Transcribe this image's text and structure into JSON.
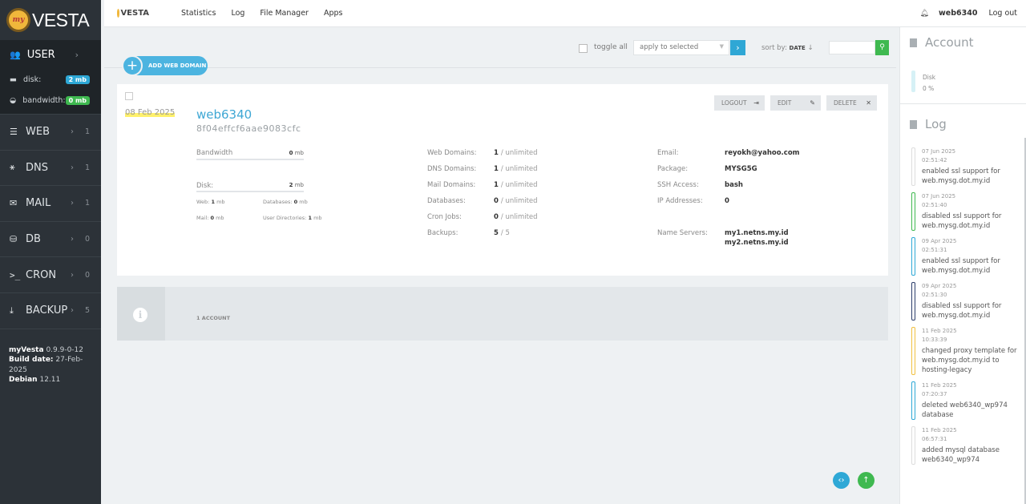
{
  "sidebar": {
    "logo_text": "VESTA",
    "logo_badge": "my",
    "user": {
      "label": "USER",
      "arrow": "›"
    },
    "stats": [
      {
        "label": "disk:",
        "value": "2 mb",
        "color": "#2ea8d6"
      },
      {
        "label": "bandwidth:",
        "value": "0 mb",
        "color": "#3fb950"
      }
    ],
    "nav": [
      {
        "label": "WEB",
        "count": "1",
        "icon": "web-icon"
      },
      {
        "label": "DNS",
        "count": "1",
        "icon": "dns-icon"
      },
      {
        "label": "MAIL",
        "count": "1",
        "icon": "mail-icon"
      },
      {
        "label": "DB",
        "count": "0",
        "icon": "db-icon"
      },
      {
        "label": "CRON",
        "count": "0",
        "icon": "cron-icon"
      },
      {
        "label": "BACKUP",
        "count": "5",
        "icon": "backup-icon"
      }
    ],
    "version": {
      "name": "myVesta",
      "version": "0.9.9-0-12",
      "build_label": "Build date:",
      "build": "27-Feb-2025",
      "os": "Debian",
      "os_version": "12.11"
    }
  },
  "topbar": {
    "logo": "VESTA",
    "links": [
      "Statistics",
      "Log",
      "File Manager",
      "Apps"
    ],
    "username": "web6340",
    "logout": "Log out"
  },
  "toolbar": {
    "toggle_all": "toggle all",
    "apply_placeholder": "apply to selected",
    "sort_label": "sort by:",
    "sort_value": "DATE",
    "add_label": "ADD WEB DOMAIN"
  },
  "card": {
    "date": "08 Feb 2025",
    "name": "web6340",
    "hash": "8f04effcf6aae9083cfc",
    "buttons": {
      "logout": "LOGOUT",
      "edit": "EDIT",
      "delete": "DELETE"
    },
    "bandwidth": {
      "label": "Bandwidth",
      "value": "0",
      "unit": "mb"
    },
    "disk": {
      "label": "Disk:",
      "value": "2",
      "unit": "mb"
    },
    "disk_details": {
      "web_label": "Web:",
      "web": "1",
      "db_label": "Databases:",
      "db": "0",
      "mail_label": "Mail:",
      "mail": "0",
      "udir_label": "User Directories:",
      "udir": "1",
      "unit": "mb"
    },
    "mid": [
      {
        "k": "Web Domains:",
        "v": "1",
        "of": "/ unlimited"
      },
      {
        "k": "DNS Domains:",
        "v": "1",
        "of": "/ unlimited"
      },
      {
        "k": "Mail Domains:",
        "v": "1",
        "of": "/ unlimited"
      },
      {
        "k": "Databases:",
        "v": "0",
        "of": "/ unlimited"
      },
      {
        "k": "Cron Jobs:",
        "v": "0",
        "of": "/ unlimited"
      },
      {
        "k": "Backups:",
        "v": "5",
        "of": "/ 5"
      }
    ],
    "right": [
      {
        "k": "Email:",
        "v": "reyokh@yahoo.com"
      },
      {
        "k": "Package:",
        "v": "MYSG5G"
      },
      {
        "k": "SSH Access:",
        "v": "bash"
      },
      {
        "k": "IP Addresses:",
        "v": "0"
      }
    ],
    "ns_label": "Name Servers:",
    "ns": [
      "my1.netns.my.id",
      "my2.netns.my.id"
    ]
  },
  "footer": {
    "count": "1 ACCOUNT"
  },
  "panel": {
    "account_title": "Account",
    "disk_label": "Disk",
    "disk_value": "0 %",
    "log_title": "Log",
    "logs": [
      {
        "date": "07 Jun 2025",
        "time": "02:51:42",
        "msg": "enabled ssl support for web.mysg.dot.my.id",
        "color": "#dddddd"
      },
      {
        "date": "07 Jun 2025",
        "time": "02:51:40",
        "msg": "disabled ssl support for web.mysg.dot.my.id",
        "color": "#3fb950"
      },
      {
        "date": "09 Apr 2025",
        "time": "02:51:31",
        "msg": "enabled ssl support for web.mysg.dot.my.id",
        "color": "#2ea8d6"
      },
      {
        "date": "09 Apr 2025",
        "time": "02:51:30",
        "msg": "disabled ssl support for web.mysg.dot.my.id",
        "color": "#2c3e6b"
      },
      {
        "date": "11 Feb 2025",
        "time": "10:33:39",
        "msg": "changed proxy template for web.mysg.dot.my.id to hosting-legacy",
        "color": "#f0c040"
      },
      {
        "date": "11 Feb 2025",
        "time": "07:20:37",
        "msg": "deleted web6340_wp974 database",
        "color": "#2ea8d6"
      },
      {
        "date": "11 Feb 2025",
        "time": "06:57:31",
        "msg": "added mysql database web6340_wp974",
        "color": "#dddddd"
      }
    ]
  }
}
